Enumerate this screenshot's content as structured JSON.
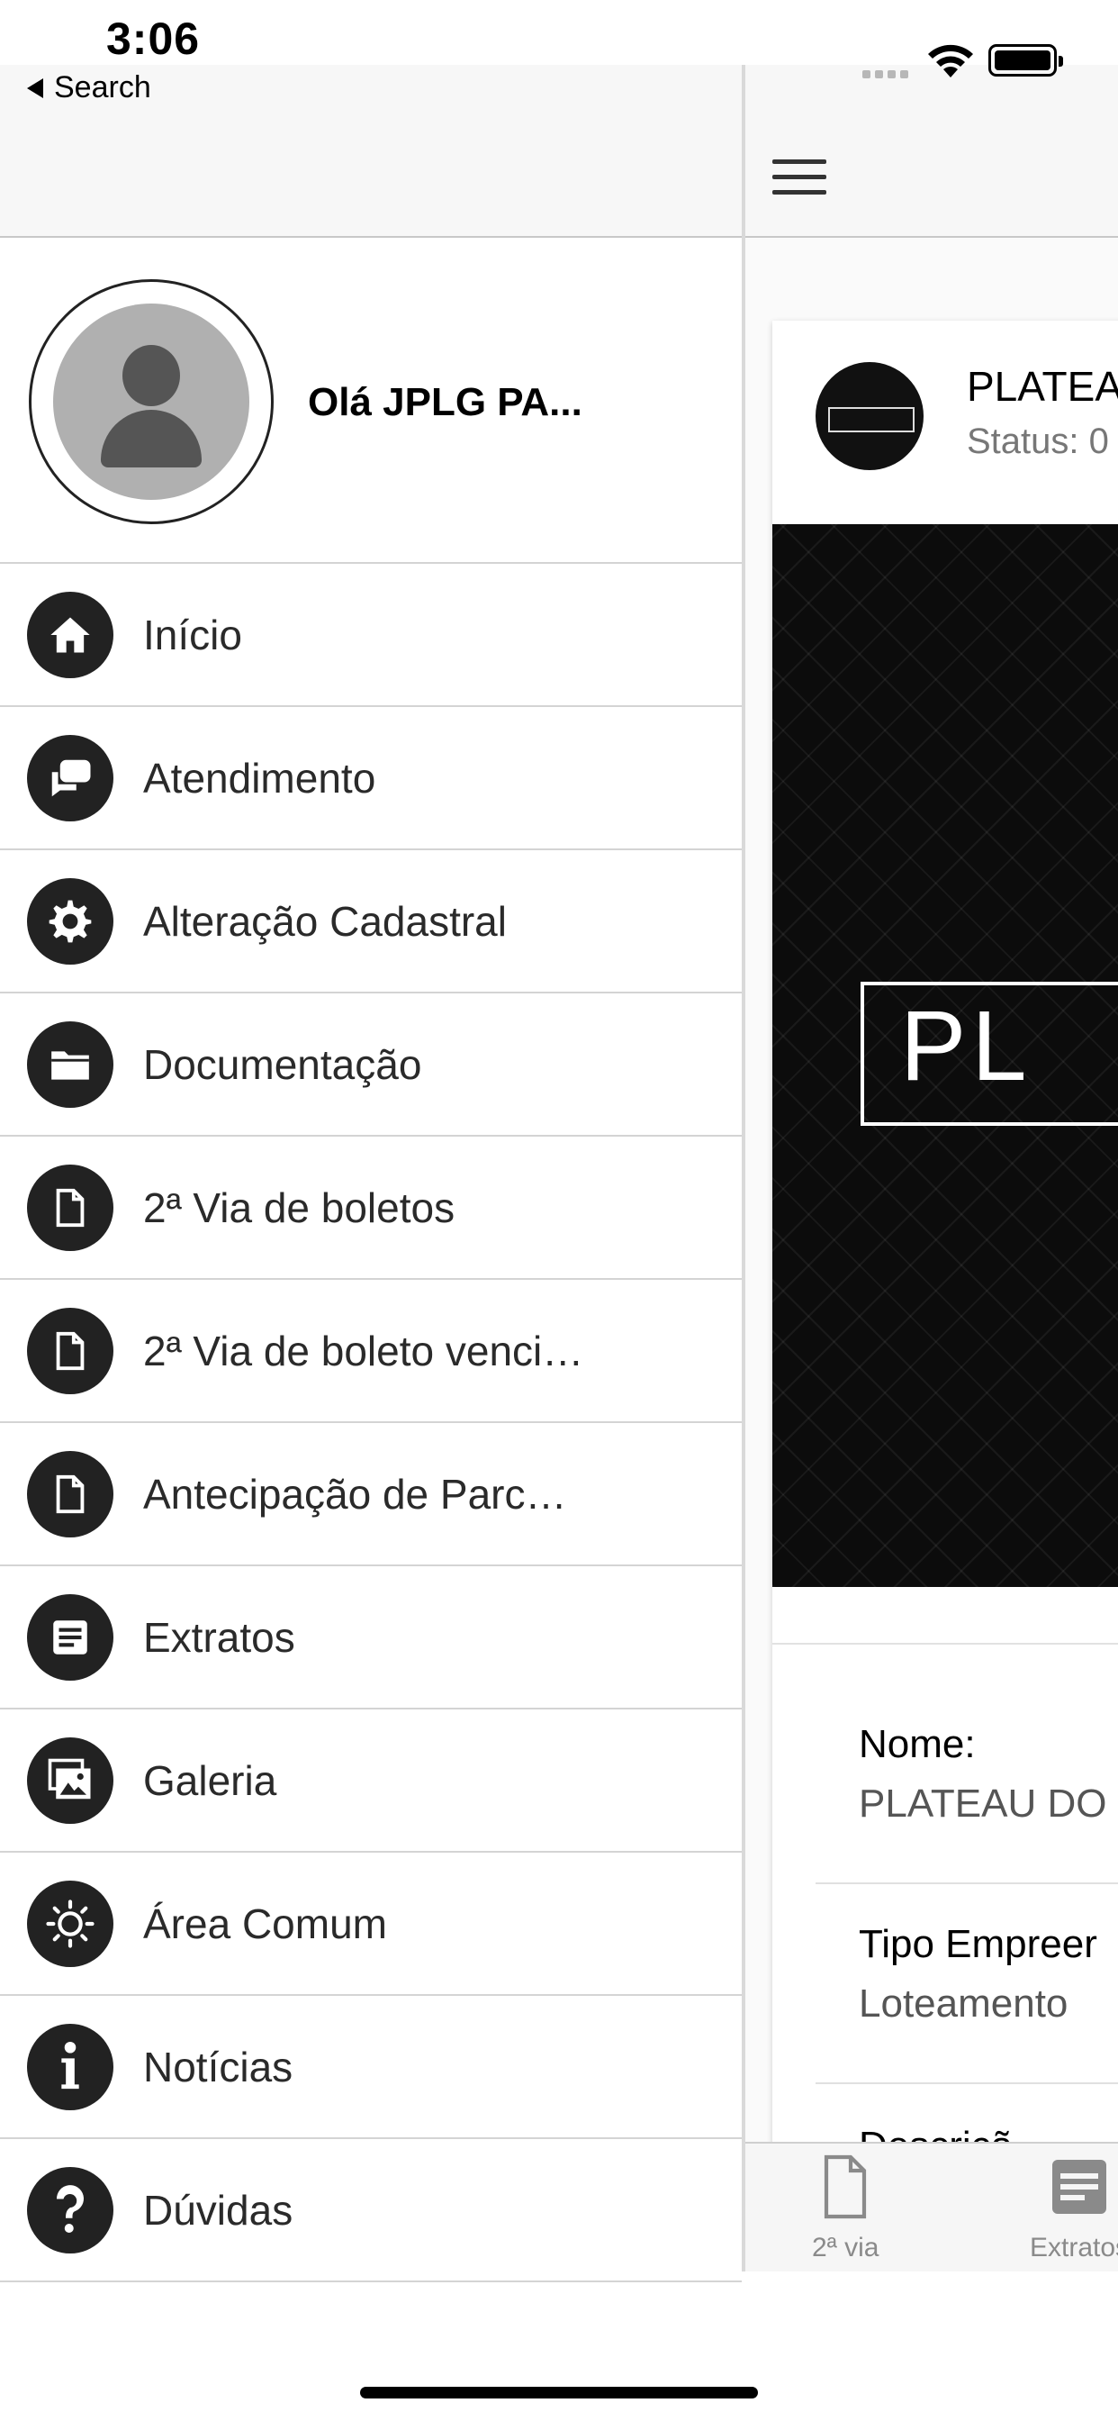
{
  "status_bar": {
    "time": "3:06",
    "back_label": "Search"
  },
  "drawer": {
    "greeting": "Olá JPLG PA...",
    "items": [
      {
        "label": "Início",
        "icon": "home-icon"
      },
      {
        "label": "Atendimento",
        "icon": "chat-icon"
      },
      {
        "label": "Alteração Cadastral",
        "icon": "gear-icon"
      },
      {
        "label": "Documentação",
        "icon": "folder-icon"
      },
      {
        "label": "2ª Via de boletos",
        "icon": "document-icon"
      },
      {
        "label": "2ª Via de boleto venci…",
        "icon": "document-icon"
      },
      {
        "label": "Antecipação de Parc…",
        "icon": "document-icon"
      },
      {
        "label": "Extratos",
        "icon": "list-document-icon"
      },
      {
        "label": "Galeria",
        "icon": "gallery-icon"
      },
      {
        "label": "Área Comum",
        "icon": "sun-icon"
      },
      {
        "label": "Notícias",
        "icon": "info-icon"
      },
      {
        "label": "Dúvidas",
        "icon": "question-icon"
      }
    ]
  },
  "content": {
    "card_title": "PLATEA",
    "card_status": "Status: 0",
    "banner_text": "PL",
    "logo_text": "PLATEAU",
    "fields": [
      {
        "label": "Nome:",
        "value": "PLATEAU DO"
      },
      {
        "label": "Tipo Empreer",
        "value": "Loteamento"
      },
      {
        "label": "Descriçã",
        "value": ""
      }
    ]
  },
  "tabbar": {
    "tabs": [
      {
        "label": "2ª via",
        "icon": "document-icon"
      },
      {
        "label": "Extratos",
        "icon": "list-document-icon"
      }
    ]
  }
}
